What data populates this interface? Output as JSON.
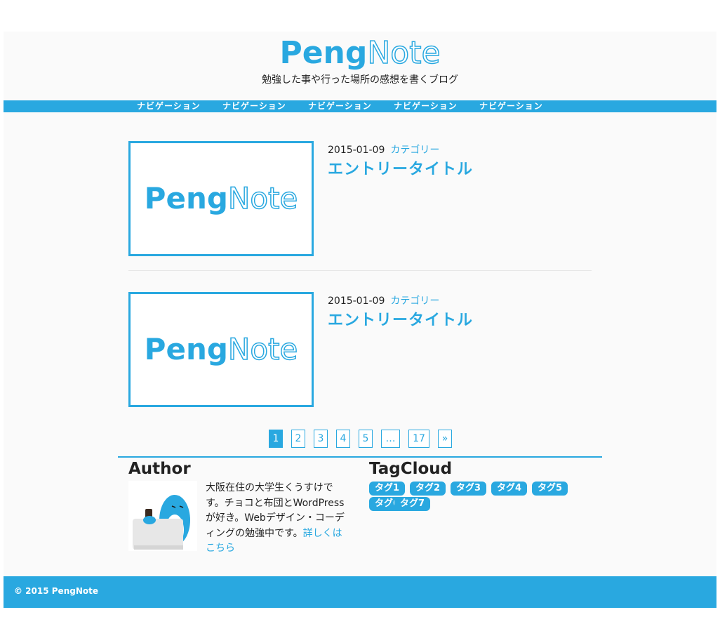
{
  "header": {
    "logo_peng": "Peng",
    "logo_note": "Note",
    "tagline": "勉強した事や行った場所の感想を書くブログ"
  },
  "nav": {
    "items": [
      "ナビゲーション",
      "ナビゲーション",
      "ナビゲーション",
      "ナビゲーション",
      "ナビゲーション"
    ]
  },
  "entries": [
    {
      "date": "2015-01-09",
      "category": "カテゴリー",
      "title": "エントリータイトル",
      "thumb_peng": "Peng",
      "thumb_note": "Note"
    },
    {
      "date": "2015-01-09",
      "category": "カテゴリー",
      "title": "エントリータイトル",
      "thumb_peng": "Peng",
      "thumb_note": "Note"
    }
  ],
  "pagination": {
    "pages": [
      "1",
      "2",
      "3",
      "4",
      "5",
      "…",
      "17",
      "»"
    ],
    "current": "1"
  },
  "author": {
    "title": "Author",
    "bio": "大阪在住の大学生くうすけです。チョコと布団とWordPressが好き。Webデザイン・コーディングの勉強中です。",
    "link": "詳しくはこちら"
  },
  "tagcloud": {
    "title": "TagCloud",
    "tags": [
      "タグ1",
      "タグ2",
      "タグ3",
      "タグ4",
      "タグ5",
      "タグ6",
      "タグ7"
    ]
  },
  "footer": {
    "copyright": "© 2015 PengNote"
  },
  "colors": {
    "accent": "#29a8e0",
    "background": "#fafafa"
  }
}
